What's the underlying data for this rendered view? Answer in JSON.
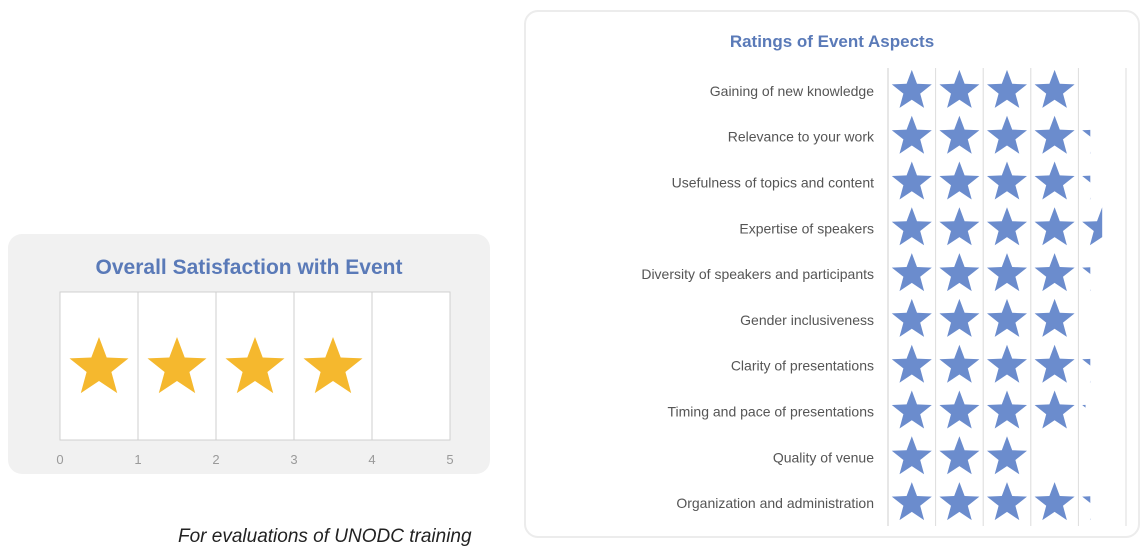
{
  "colors": {
    "gold_star": "#f5b82e",
    "blue_star": "#6b8ccd",
    "title": "#5a7ab8"
  },
  "caption": "For evaluations of UNODC training",
  "chart_data": [
    {
      "type": "bar",
      "title": "Overall Satisfaction with Event",
      "categories": [
        "Overall"
      ],
      "values": [
        4.0
      ],
      "xlim": [
        0,
        5
      ],
      "ticks": [
        "0",
        "1",
        "2",
        "3",
        "4",
        "5"
      ],
      "marker": "star",
      "grid": true
    },
    {
      "type": "bar",
      "title": "Ratings of Event Aspects",
      "categories": [
        "Gaining of new knowledge",
        "Relevance to your work",
        "Usefulness of topics and content",
        "Expertise of speakers",
        "Diversity of speakers and participants",
        "Gender inclusiveness",
        "Clarity of presentations",
        "Timing and pace of presentations",
        "Quality of venue",
        "Organization and administration"
      ],
      "values": [
        4.0,
        4.25,
        4.25,
        4.5,
        4.25,
        4.0,
        4.25,
        4.15,
        3.05,
        4.25
      ],
      "xlim": [
        0,
        5
      ],
      "marker": "star",
      "grid": true
    }
  ]
}
